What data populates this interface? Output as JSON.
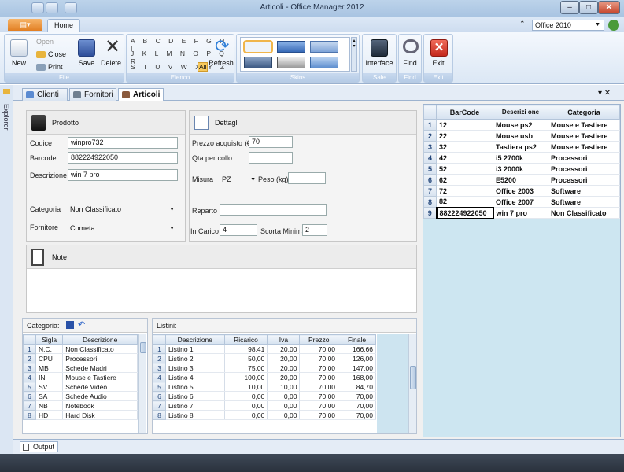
{
  "window": {
    "title": "Articoli - Office Manager 2012",
    "min": "–",
    "max": "□",
    "close": "✕"
  },
  "ribbon": {
    "app_menu": "▤▾",
    "tab_home": "Home",
    "theme_selector": "Office 2010",
    "collapse": "⌃",
    "file_group": {
      "label": "File",
      "new": "New",
      "open": "Open",
      "close": "Close",
      "print": "Print",
      "save": "Save",
      "delete": "Delete"
    },
    "elenco_group": {
      "label": "Elenco",
      "row1": "A B C D E F G H I",
      "row2": "J K L M N O P Q R",
      "row3": "S T U V W X Y Z",
      "all": "All",
      "refresh": "Refresh"
    },
    "skins_group": {
      "label": "Skins"
    },
    "sale_group": {
      "label": "Sale",
      "interface": "Interface"
    },
    "find_group": {
      "label": "Find",
      "find": "Find"
    },
    "exit_group": {
      "label": "Exit",
      "exit": "Exit"
    }
  },
  "explorer": {
    "label": "Explorer"
  },
  "doc_tabs": [
    {
      "label": "Clienti"
    },
    {
      "label": "Fornitori"
    },
    {
      "label": "Articoli"
    }
  ],
  "doc_controls": "▾ ✕",
  "prodotto": {
    "title": "Prodotto",
    "codice_label": "Codice",
    "codice": "winpro732",
    "barcode_label": "Barcode",
    "barcode": "882224922050",
    "descrizione_label": "Descrizione",
    "descrizione": "win 7 pro",
    "categoria_label": "Categoria",
    "categoria": "Non Classificato",
    "fornitore_label": "Fornitore",
    "fornitore": "Cometa"
  },
  "dettagli": {
    "title": "Dettagli",
    "prezzo_label": "Prezzo acquisto (€)",
    "prezzo": "70",
    "qta_label": "Qta per collo",
    "qta": "",
    "misura_label": "Misura",
    "misura": "PZ",
    "peso_label": "Peso (kg)",
    "peso": "",
    "reparto_label": "Reparto",
    "reparto": "",
    "incarico_label": "In Carico",
    "incarico": "4",
    "scorta_label": "Scorta Minima",
    "scorta": "2"
  },
  "note": {
    "title": "Note"
  },
  "categorie": {
    "title": "Categoria:",
    "headers": [
      "Sigla",
      "Descrizione"
    ],
    "rows": [
      [
        "1",
        "N.C.",
        "Non Classificato"
      ],
      [
        "2",
        "CPU",
        "Processori"
      ],
      [
        "3",
        "MB",
        "Schede Madri"
      ],
      [
        "4",
        "IN",
        "Mouse e Tastiere"
      ],
      [
        "5",
        "SV",
        "Schede Video"
      ],
      [
        "6",
        "SA",
        "Schede Audio"
      ],
      [
        "7",
        "NB",
        "Notebook"
      ],
      [
        "8",
        "HD",
        "Hard Disk"
      ]
    ]
  },
  "listini": {
    "title": "Listini:",
    "headers": [
      "Descrizione",
      "Ricarico",
      "Iva",
      "Prezzo",
      "Finale"
    ],
    "rows": [
      [
        "1",
        "Listino 1",
        "98,41",
        "20,00",
        "70,00",
        "166,66"
      ],
      [
        "2",
        "Listino 2",
        "50,00",
        "20,00",
        "70,00",
        "126,00"
      ],
      [
        "3",
        "Listino 3",
        "75,00",
        "20,00",
        "70,00",
        "147,00"
      ],
      [
        "4",
        "Listino 4",
        "100,00",
        "20,00",
        "70,00",
        "168,00"
      ],
      [
        "5",
        "Listino 5",
        "10,00",
        "10,00",
        "70,00",
        "84,70"
      ],
      [
        "6",
        "Listino 6",
        "0,00",
        "0,00",
        "70,00",
        "70,00"
      ],
      [
        "7",
        "Listino 7",
        "0,00",
        "0,00",
        "70,00",
        "70,00"
      ],
      [
        "8",
        "Listino 8",
        "0,00",
        "0,00",
        "70,00",
        "70,00"
      ]
    ]
  },
  "articoli_grid": {
    "headers": [
      "BarCode",
      "Descrizi one",
      "Categoria"
    ],
    "rows": [
      [
        "1",
        "12",
        "Mouse ps2",
        "Mouse e Tastiere"
      ],
      [
        "2",
        "22",
        "Mouse usb",
        "Mouse e Tastiere"
      ],
      [
        "3",
        "32",
        "Tastiera ps2",
        "Mouse e Tastiere"
      ],
      [
        "4",
        "42",
        "i5 2700k",
        "Processori"
      ],
      [
        "5",
        "52",
        "i3 2000k",
        "Processori"
      ],
      [
        "6",
        "62",
        "E5200",
        "Processori"
      ],
      [
        "7",
        "72",
        "Office 2003",
        "Software"
      ],
      [
        "8",
        "82",
        "Office 2007",
        "Software"
      ],
      [
        "9",
        "882224922050",
        "win 7 pro",
        "Non Classificato"
      ]
    ]
  },
  "output": {
    "label": "Output"
  }
}
